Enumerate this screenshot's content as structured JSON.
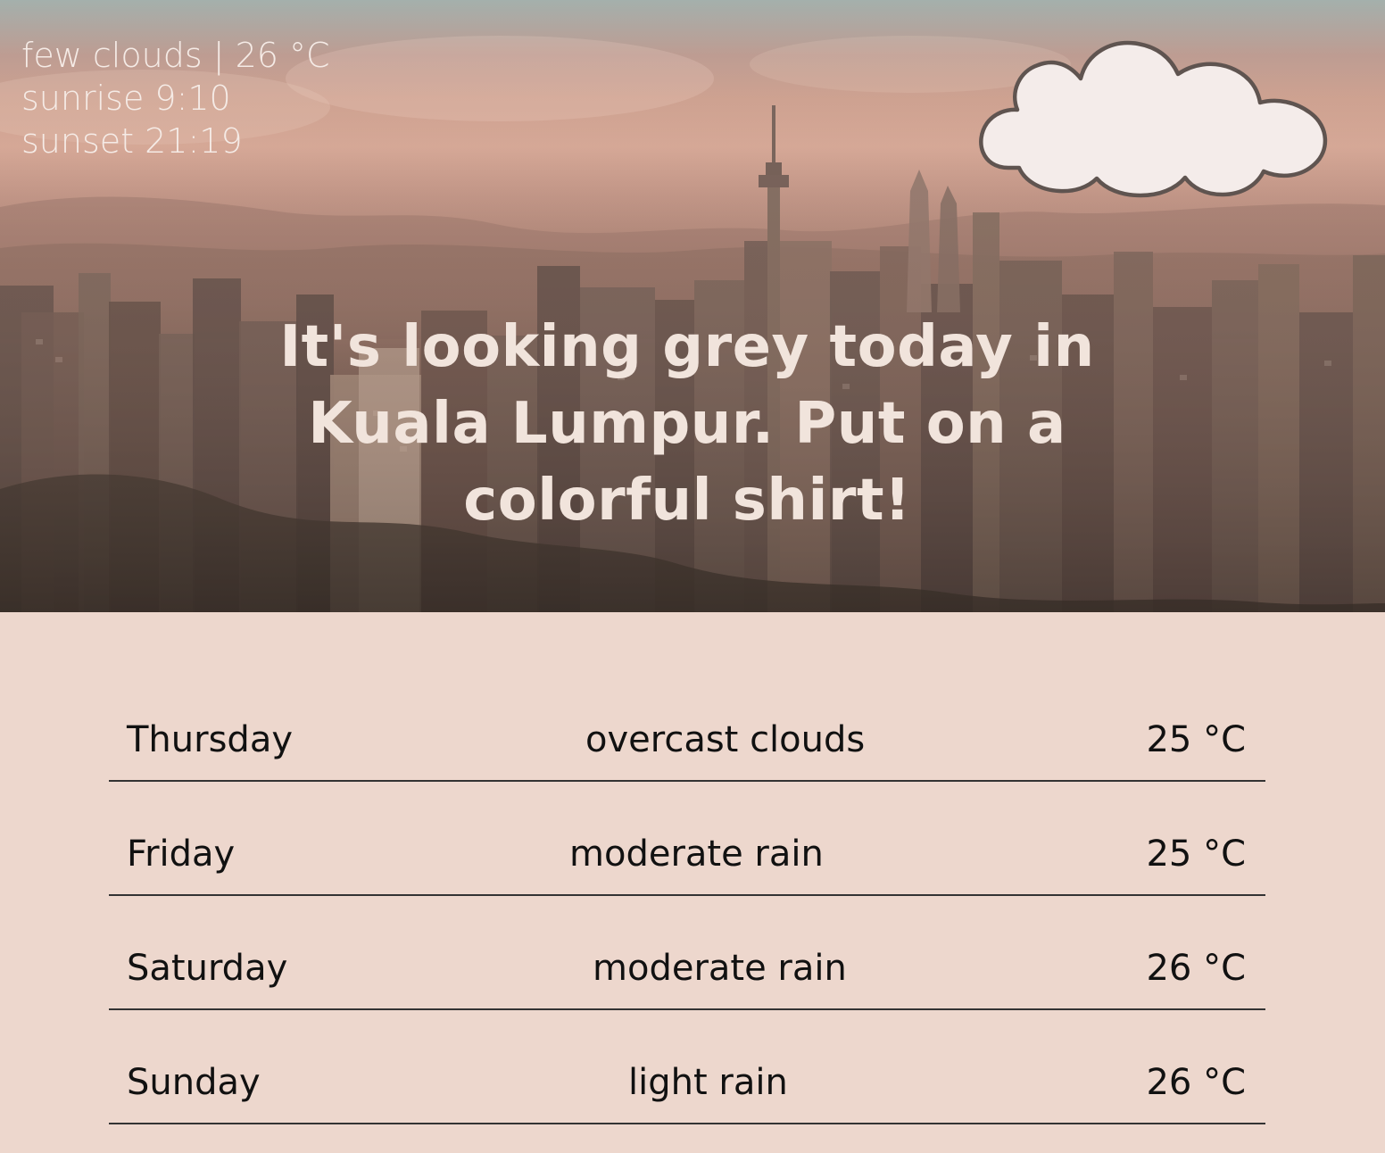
{
  "current": {
    "condition_temp": "few clouds | 26 °C",
    "sunrise": "sunrise 9:10",
    "sunset": "sunset 21:19"
  },
  "headline": "It's looking grey today in Kuala Lumpur. Put on a colorful shirt!",
  "forecast": [
    {
      "day": "Thursday",
      "description": "overcast clouds",
      "temperature": "25 °C"
    },
    {
      "day": "Friday",
      "description": "moderate rain",
      "temperature": "25 °C"
    },
    {
      "day": "Saturday",
      "description": "moderate rain",
      "temperature": "26 °C"
    },
    {
      "day": "Sunday",
      "description": "light rain",
      "temperature": "26 °C"
    }
  ],
  "icons": {
    "weather": "cloud-icon"
  },
  "colors": {
    "background": "#edd7cd",
    "hero_text": "#f1e4dc",
    "row_divider": "#333333"
  }
}
